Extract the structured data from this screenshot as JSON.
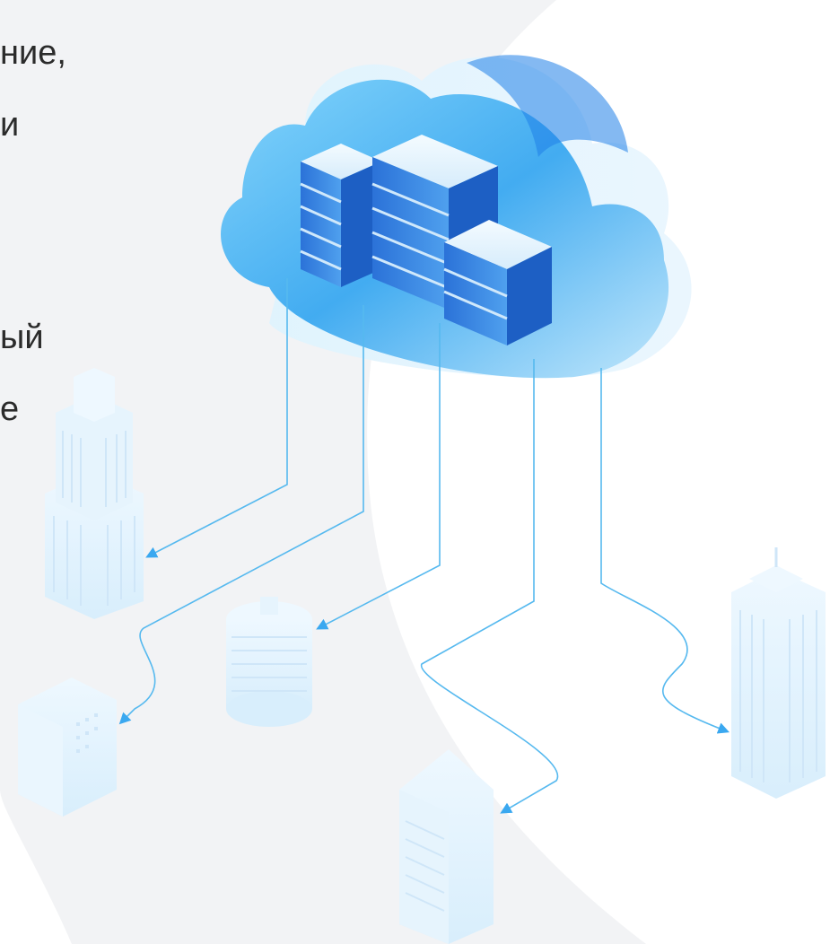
{
  "text_fragments": [
    {
      "text": "ние,"
    },
    {
      "text": "и"
    },
    {
      "text": "ый"
    },
    {
      "text": "е"
    }
  ],
  "colors": {
    "background": "#ffffff",
    "backdrop": "#f2f3f5",
    "cloud_light": "#bfe6fb",
    "cloud_mid": "#5ab8f3",
    "cloud_deep": "#1f7fe8",
    "server": "#2d7fe0",
    "connector": "#56b9ef",
    "building": "#e4f3fd"
  },
  "icons": [
    "cloud-server-icon",
    "office-building-icon",
    "connector-arrow-icon"
  ]
}
